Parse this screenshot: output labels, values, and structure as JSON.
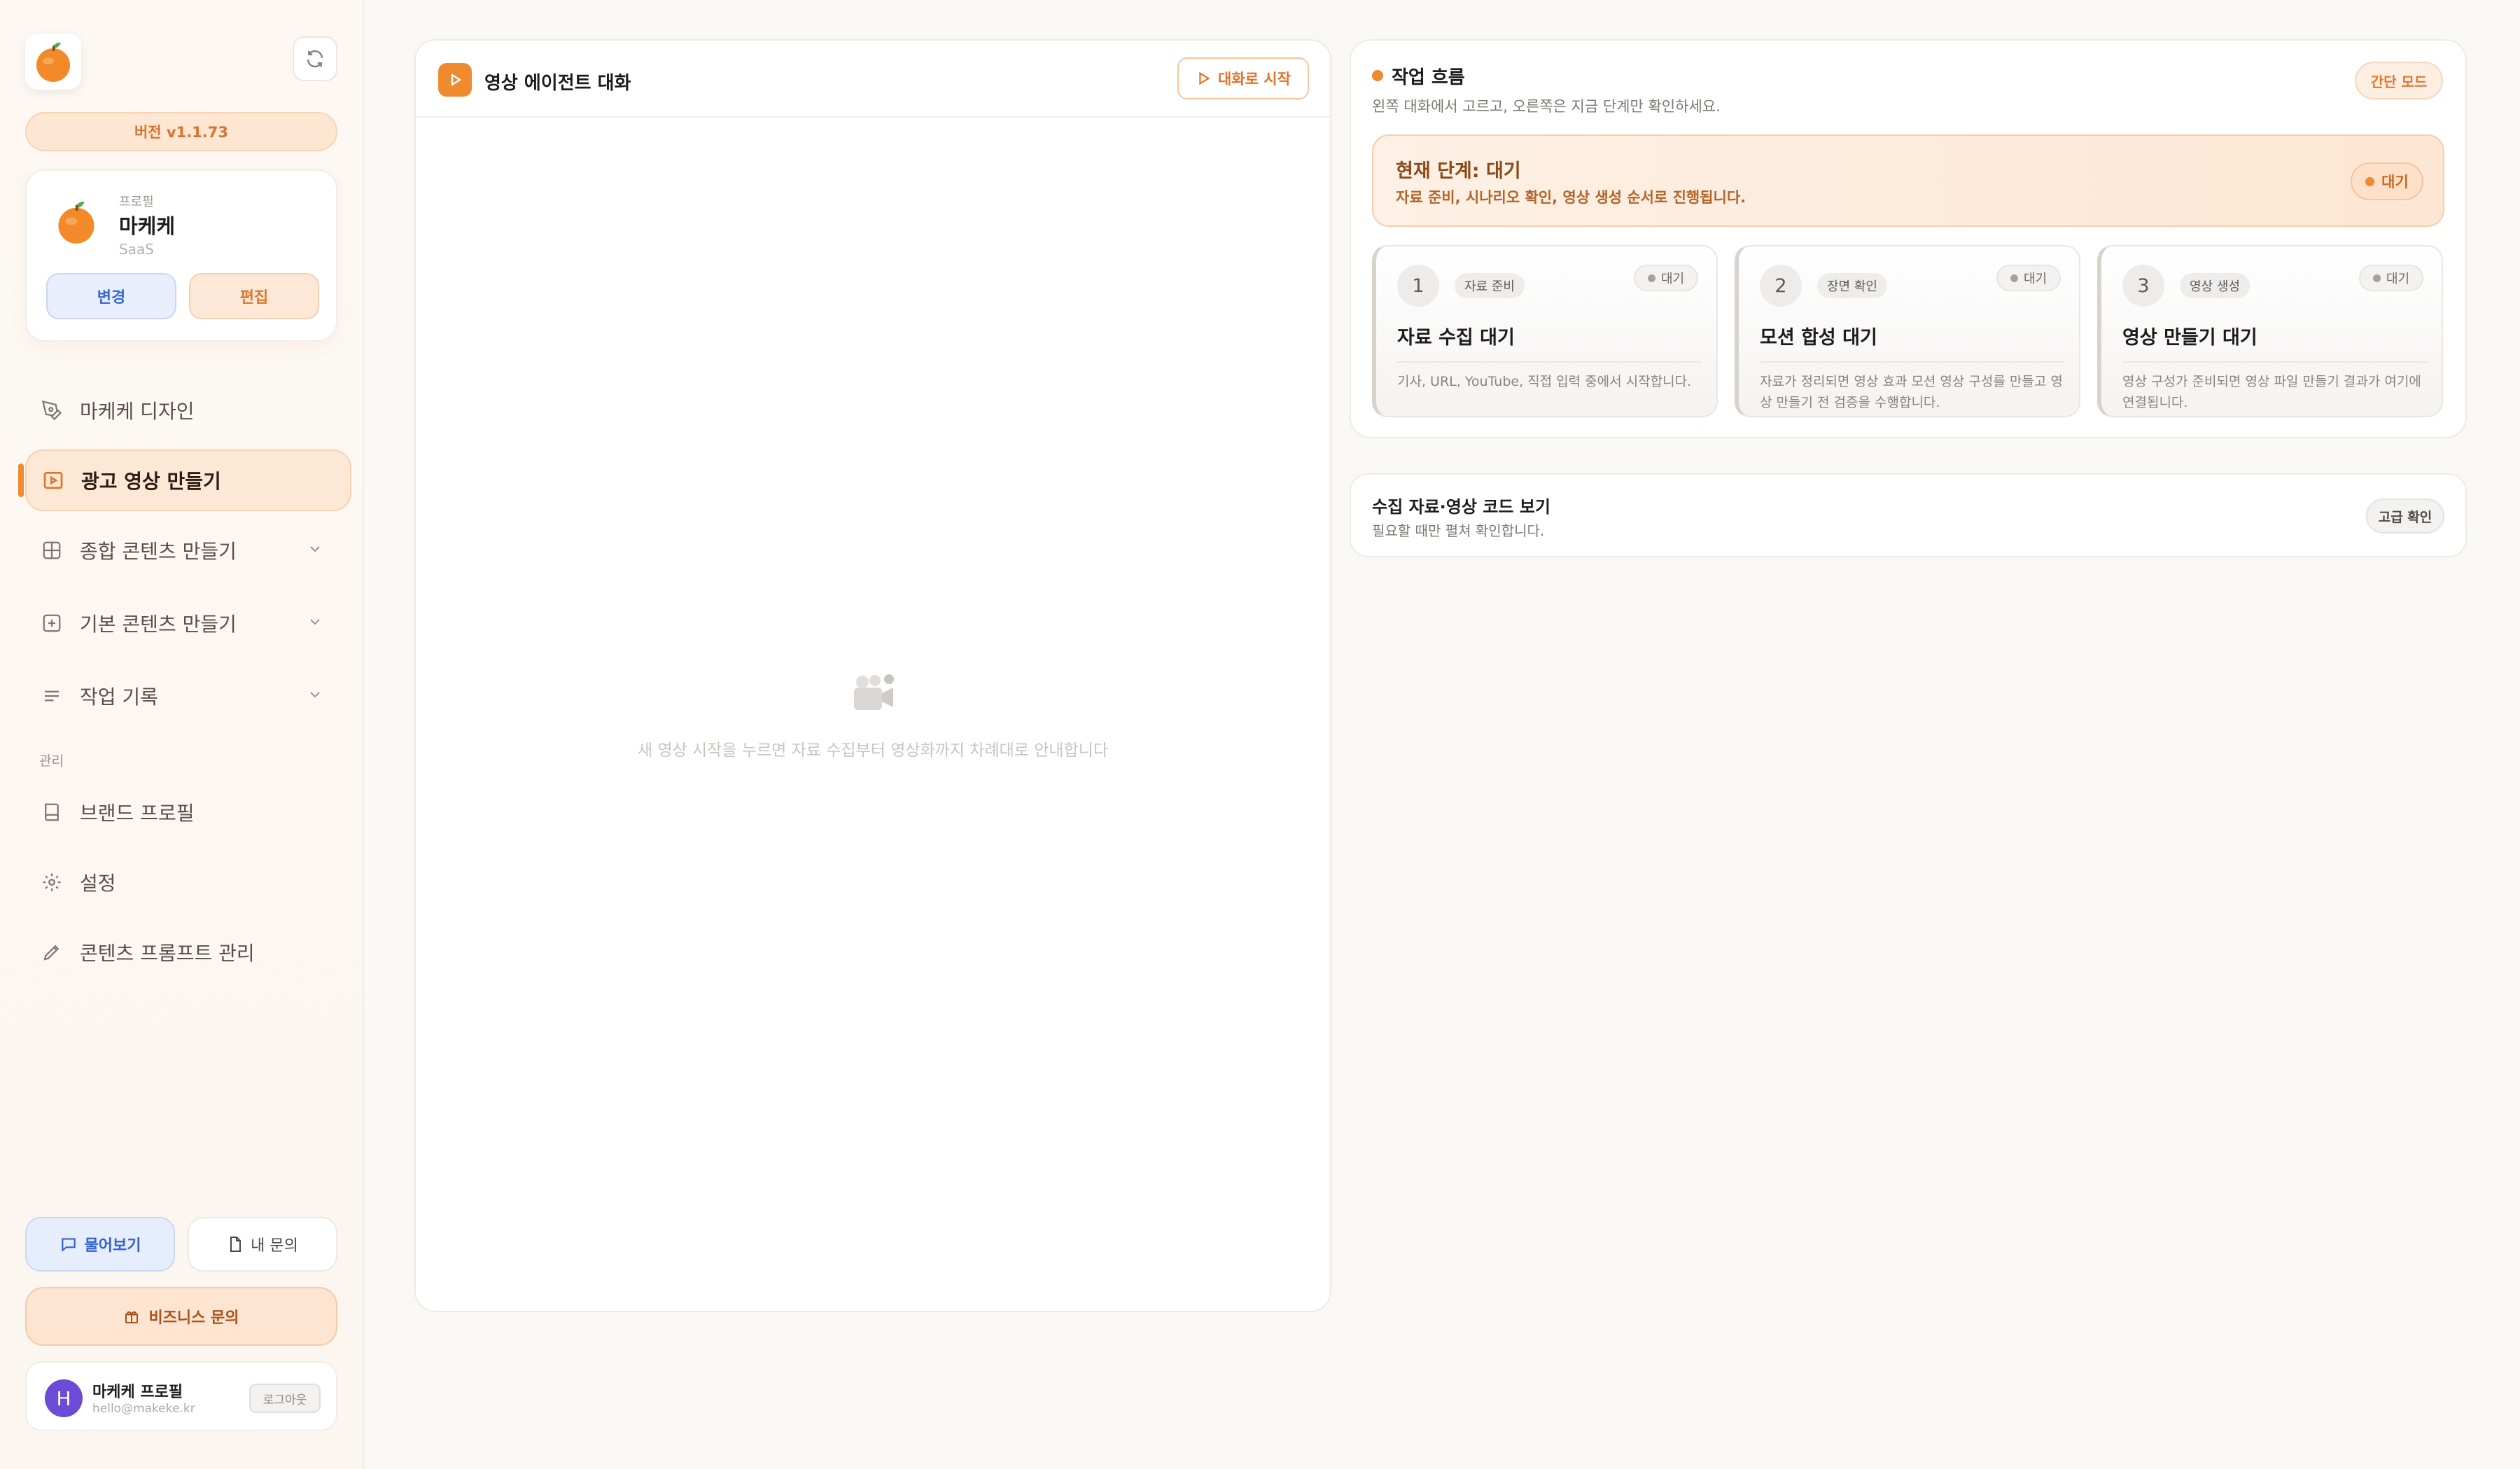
{
  "sidebar": {
    "version": "버전 v1.1.73",
    "profile": {
      "label": "프로필",
      "name": "마케케",
      "industry": "SaaS",
      "change_label": "변경",
      "edit_label": "편집"
    },
    "nav": {
      "design": "마케케 디자인",
      "video_ad": "광고 영상 만들기",
      "integrated_content": "종합 콘텐츠 만들기",
      "basic_content": "기본 콘텐츠 만들기",
      "history": "작업 기록"
    },
    "section_manage": "관리",
    "manage": {
      "brand_profile": "브랜드 프로필",
      "settings": "설정",
      "prompt_manage": "콘텐츠 프롬프트 관리"
    },
    "ask_label": "물어보기",
    "my_inquiry_label": "내 문의",
    "business_label": "비즈니스 문의",
    "user": {
      "initial": "H",
      "name": "마케케 프로필",
      "email": "hello@makeke.kr",
      "logout_label": "로그아웃"
    }
  },
  "chat": {
    "title": "영상 에이전트 대화",
    "start_label": "대화로 시작",
    "empty_text": "새 영상 시작을 누르면 자료 수집부터 영상화까지 차례대로 안내합니다"
  },
  "workflow": {
    "title": "작업 흐름",
    "subtitle": "왼쪽 대화에서 고르고, 오른쪽은 지금 단계만 확인하세요.",
    "simple_mode_label": "간단 모드",
    "current_stage": {
      "title": "현재 단계: 대기",
      "desc": "자료 준비, 시나리오 확인, 영상 생성 순서로 진행됩니다.",
      "badge": "대기"
    },
    "steps": [
      {
        "num": "1",
        "tag": "자료 준비",
        "status": "대기",
        "title": "자료 수집 대기",
        "desc": "기사, URL, YouTube, 직접 입력 중에서 시작합니다."
      },
      {
        "num": "2",
        "tag": "장면 확인",
        "status": "대기",
        "title": "모션 합성 대기",
        "desc": "자료가 정리되면 영상 효과 모션 영상 구성를 만들고 영상 만들기 전 검증을 수행합니다."
      },
      {
        "num": "3",
        "tag": "영상 생성",
        "status": "대기",
        "title": "영상 만들기 대기",
        "desc": "영상 구성가 준비되면 영상 파일 만들기 결과가 여기에 연결됩니다."
      }
    ]
  },
  "data_panel": {
    "title": "수집 자료·영상 코드 보기",
    "subtitle": "필요할 때만 펼쳐 확인합니다.",
    "advanced_label": "고급 확인"
  },
  "colors": {
    "accent": "#f08a2e",
    "blue": "#3766d3",
    "avatar": "#6c4bd6"
  }
}
